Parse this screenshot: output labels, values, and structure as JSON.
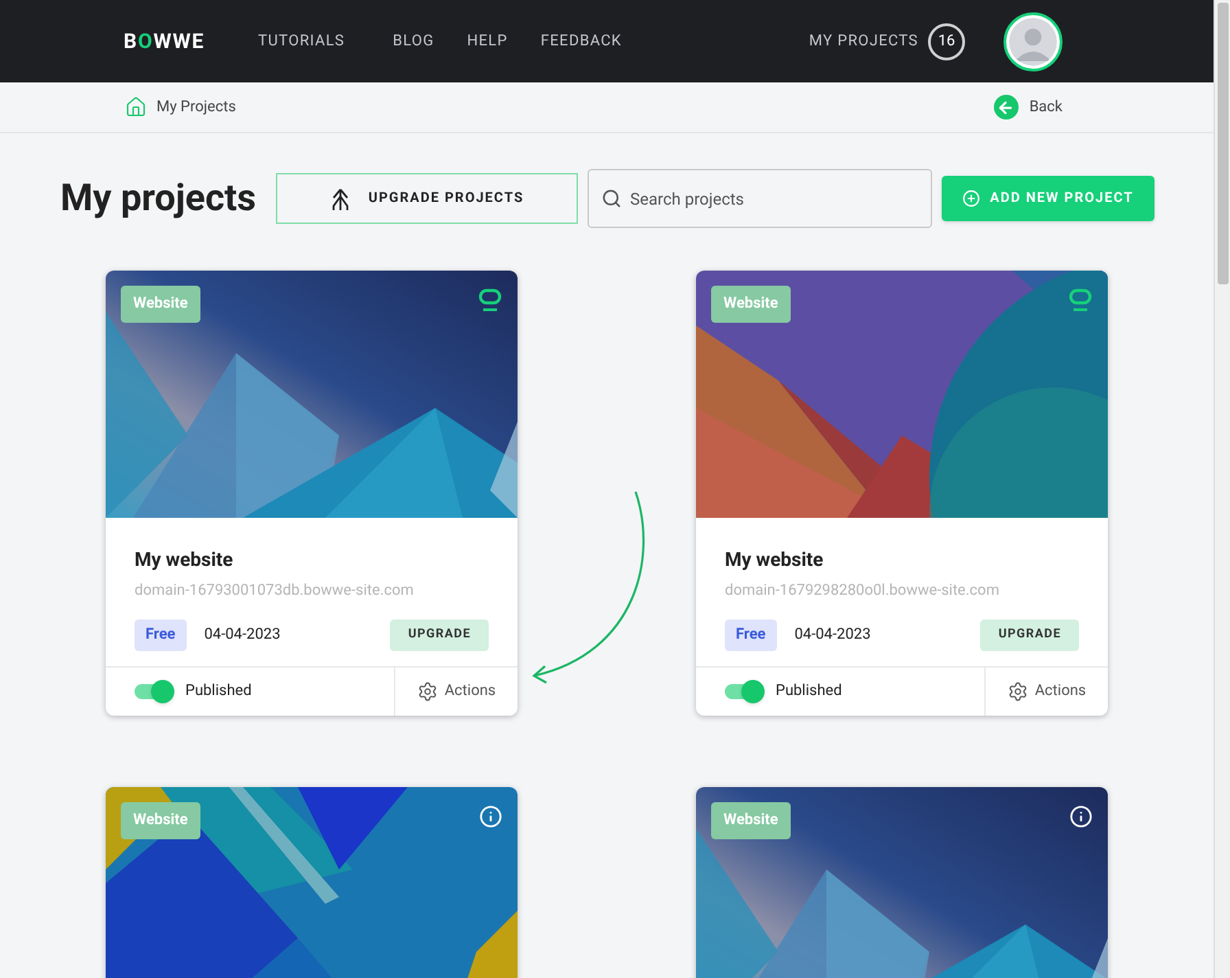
{
  "header": {
    "logo": "BOWWE",
    "nav": [
      "TUTORIALS",
      "BLOG",
      "HELP",
      "FEEDBACK"
    ],
    "projects_link": "MY PROJECTS",
    "projects_count": "16"
  },
  "breadcrumb": {
    "label": "My Projects",
    "back": "Back"
  },
  "toolbar": {
    "title": "My projects",
    "upgrade": "UPGRADE PROJECTS",
    "search": {
      "placeholder": "Search projects"
    },
    "add": "ADD NEW PROJECT"
  },
  "cards": [
    {
      "tag": "Website",
      "kind": "logo",
      "title": "My website",
      "domain": "domain-16793001073db.bowwe-site.com",
      "plan": "Free",
      "date": "04-04-2023",
      "upgrade": "UPGRADE",
      "published": true,
      "status": "Published",
      "actions": "Actions"
    },
    {
      "tag": "Website",
      "kind": "logo",
      "title": "My website",
      "domain": "domain-1679298280o0l.bowwe-site.com",
      "plan": "Free",
      "date": "04-04-2023",
      "upgrade": "UPGRADE",
      "published": true,
      "status": "Published",
      "actions": "Actions"
    },
    {
      "tag": "Website",
      "kind": "info"
    },
    {
      "tag": "Website",
      "kind": "info"
    }
  ]
}
